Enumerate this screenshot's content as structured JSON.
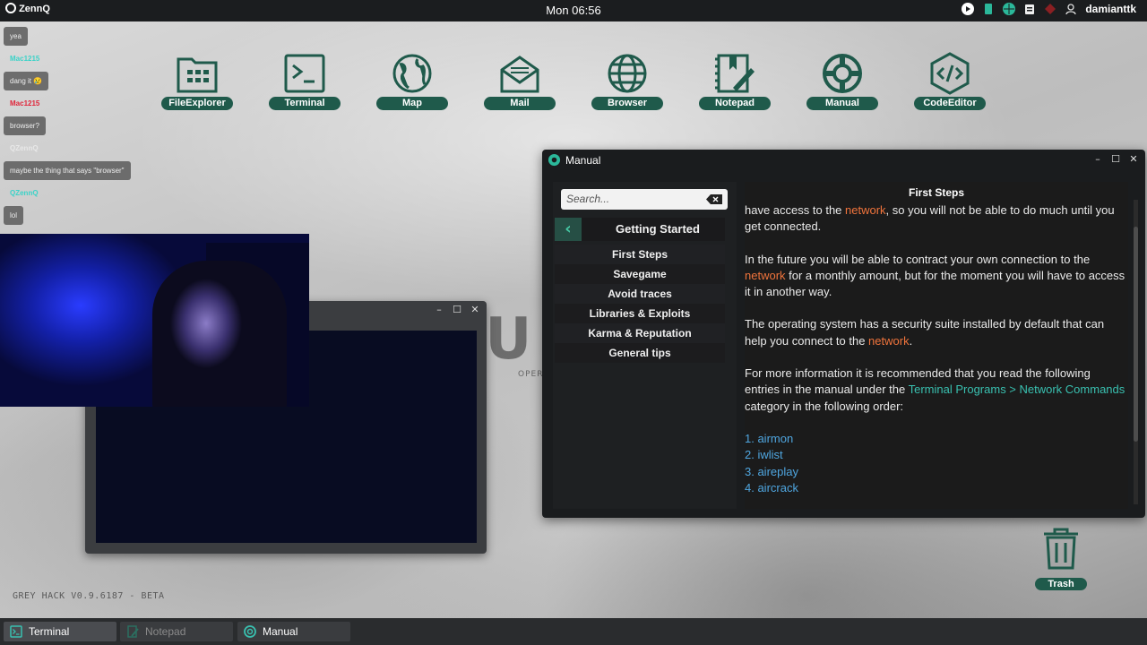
{
  "topbar": {
    "logo": "ZennQ",
    "clock": "Mon 06:56",
    "user": "damianttk",
    "colors": {
      "bar": "#1b1d1f",
      "accent": "#1f5a4b"
    }
  },
  "desktop_icons": [
    {
      "label": "FileExplorer",
      "icon": "folder-grid-icon"
    },
    {
      "label": "Terminal",
      "icon": "terminal-icon"
    },
    {
      "label": "Map",
      "icon": "globe-map-icon"
    },
    {
      "label": "Mail",
      "icon": "mail-icon"
    },
    {
      "label": "Browser",
      "icon": "browser-globe-icon"
    },
    {
      "label": "Notepad",
      "icon": "notepad-icon"
    },
    {
      "label": "Manual",
      "icon": "lifebuoy-icon"
    },
    {
      "label": "CodeEditor",
      "icon": "code-editor-icon"
    }
  ],
  "chat": [
    {
      "type": "msg",
      "text": "yea"
    },
    {
      "type": "name",
      "text": "Mac1215",
      "color": "#3ad3c8"
    },
    {
      "type": "msg",
      "text": "dang it 😢"
    },
    {
      "type": "name",
      "text": "Mac1215",
      "color": "#e0253a"
    },
    {
      "type": "msg",
      "text": "browser?"
    },
    {
      "type": "name",
      "text": "QZennQ",
      "color": "#e8e8e8"
    },
    {
      "type": "msg",
      "text": "maybe the thing that says \"browser\""
    },
    {
      "type": "name",
      "text": "QZennQ",
      "color": "#3ad3c8"
    },
    {
      "type": "msg",
      "text": "lol"
    }
  ],
  "wallpaper": {
    "logo": "eU",
    "subtitle": "OPER"
  },
  "manual": {
    "window_title": "Manual",
    "search_placeholder": "Search...",
    "category": "Getting Started",
    "sidebar_items": [
      "First Steps",
      "Savegame",
      "Avoid traces",
      "Libraries & Exploits",
      "Karma & Reputation",
      "General tips"
    ],
    "heading": "First Steps",
    "p1": {
      "a": "have access to the ",
      "link": "network",
      "b": ", so you will not be able to do much until you get connected."
    },
    "p2": {
      "a": "In the future you will be able to contract your own connection to the ",
      "link": "network",
      "b": " for a monthly amount, but for the moment you will have to access it in another way."
    },
    "p3": {
      "a": "The operating system has a security suite installed by default that can help you connect to the ",
      "link": "network",
      "b": "."
    },
    "p4": {
      "a": "For more information it is recommended that you read the following entries in the manual under the ",
      "link": "Terminal Programs > Network Commands",
      "b": " category in the following order:"
    },
    "list": [
      "1. airmon",
      "2. iwlist",
      "3. aireplay",
      "4. aircrack"
    ]
  },
  "trash": {
    "label": "Trash",
    "icon": "trash-icon"
  },
  "version": "GREY HACK V0.9.6187 - BETA",
  "taskbar": [
    {
      "label": "Terminal",
      "icon": "terminal-icon",
      "state": "active"
    },
    {
      "label": "Notepad",
      "icon": "notepad-icon",
      "state": "dim"
    },
    {
      "label": "Manual",
      "icon": "lifebuoy-icon",
      "state": "normal"
    }
  ]
}
